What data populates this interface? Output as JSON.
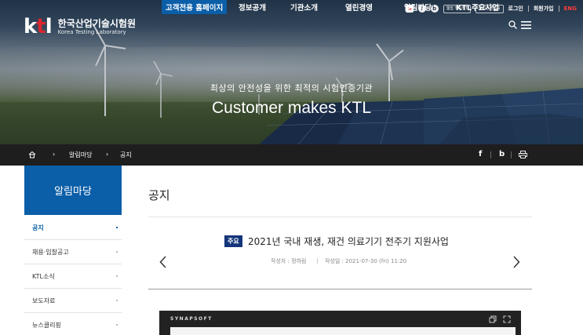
{
  "utility": {
    "social": [
      "youtube-icon",
      "facebook-icon",
      "blog-icon"
    ],
    "pills": [
      "웹접 TRUST",
      "웹접근성인증"
    ],
    "links": [
      "로그인",
      "회원가입",
      "ENG"
    ]
  },
  "logo": {
    "mark": "ktl",
    "name_ko": "한국산업기술시험원",
    "name_en": "Korea Testing Laboratory"
  },
  "nav": {
    "items": [
      "고객전용 홈페이지",
      "정보공개",
      "기관소개",
      "열린경영",
      "알림마당",
      "KTL주요사업"
    ],
    "active_index": 0
  },
  "hero": {
    "subtitle": "최상의 안전성을 위한 최적의 시험인증기관",
    "title": "Customer makes KTL"
  },
  "breadcrumb": {
    "items": [
      "알림마당",
      "공지"
    ],
    "share": [
      "f",
      "b"
    ]
  },
  "sidebar": {
    "title": "알림마당",
    "items": [
      "공지",
      "채용·입찰공고",
      "KTL소식",
      "보도자료",
      "뉴스클리핑"
    ],
    "active_index": 0
  },
  "content": {
    "page_title": "공지",
    "post": {
      "badge": "주요",
      "title": "2021년 국내 재생, 재건 의료기기 전주기 지원사업",
      "author": "작성자 : 정하림",
      "date": "작성일 : 2021-07-30 (fri) 11:20"
    }
  },
  "viewer": {
    "brand": "SYNAPSOFT"
  },
  "colors": {
    "primary": "#0b5ea8",
    "badge": "#15357a",
    "dark_bar": "#1e1e1e",
    "eng": "#ff3b3b"
  }
}
